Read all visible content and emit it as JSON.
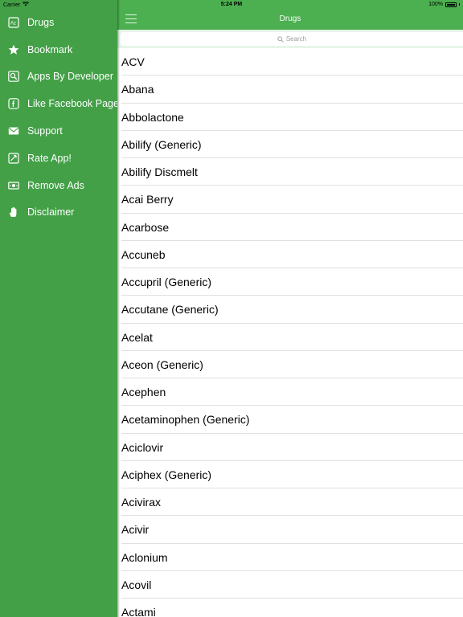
{
  "status_bar": {
    "carrier": "Carrier",
    "time": "5:24 PM",
    "battery": "100%"
  },
  "sidebar": {
    "background": "#43a047",
    "items": [
      {
        "label": "Drugs",
        "icon": "dictionary-icon"
      },
      {
        "label": "Bookmark",
        "icon": "star-icon"
      },
      {
        "label": "Apps By Developer",
        "icon": "search-apps-icon"
      },
      {
        "label": "Like Facebook Page",
        "icon": "facebook-icon"
      },
      {
        "label": "Support",
        "icon": "mail-icon"
      },
      {
        "label": "Rate App!",
        "icon": "rate-icon"
      },
      {
        "label": "Remove Ads",
        "icon": "money-icon"
      },
      {
        "label": "Disclaimer",
        "icon": "hand-icon"
      }
    ]
  },
  "navbar": {
    "title": "Drugs",
    "color": "#4caf50"
  },
  "search": {
    "placeholder": "Search"
  },
  "drugs": [
    "ACV",
    "Abana",
    "Abbolactone",
    "Abilify (Generic)",
    "Abilify Discmelt",
    "Acai Berry",
    "Acarbose",
    "Accuneb",
    "Accupril (Generic)",
    "Accutane (Generic)",
    "Acelat",
    "Aceon (Generic)",
    "Acephen",
    "Acetaminophen (Generic)",
    "Aciclovir",
    "Aciphex (Generic)",
    "Acivirax",
    "Acivir",
    "Aclonium",
    "Acovil",
    "Actami"
  ]
}
